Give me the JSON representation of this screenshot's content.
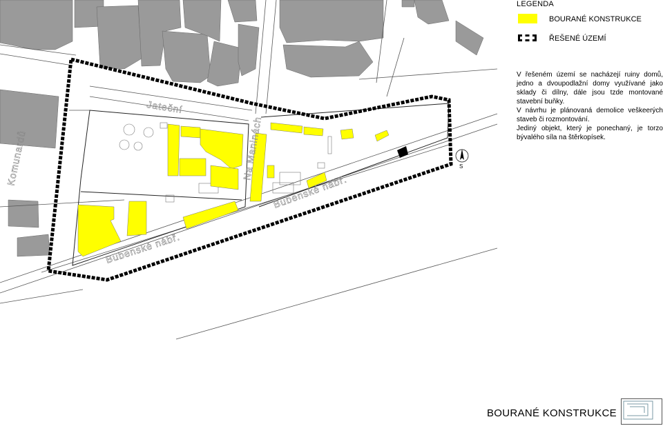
{
  "legend": {
    "title": "LEGENDA",
    "items": [
      {
        "label": "BOURANÉ KONSTRUKCE",
        "color": "#ffff00",
        "symbol": "yellow-fill"
      },
      {
        "label": "ŘEŠENÉ ÚZEMÍ",
        "color": "#000000",
        "symbol": "dashed-boundary"
      }
    ]
  },
  "notes": [
    "V řešeném území se nacházejí ruiny domů, jedno a dvoupodlažní domy využívané jako sklady či dílny, dále jsou tzde montované stavební buňky.",
    "V návrhu je plánovaná demolice veškeerých staveb či rozmontování.",
    "Jediný objekt, který je ponechaný, je torzo bývalého síla na štěrkopísek."
  ],
  "north_arrow": {
    "label": "S",
    "icon": "north-arrow-icon"
  },
  "street_labels": {
    "jatecni": "Jateční",
    "na_maninach": "Na Maninách",
    "bubenske_nabr_1": "Bubenské nábř.",
    "bubenske_nabr_2": "Bubenské nábř.",
    "komunardu": "Komunardů"
  },
  "sheet_title": "BOURANÉ KONSTRUKCE",
  "colors": {
    "demolished": "#ffff00",
    "buildings": "#9e9e9e",
    "boundary": "#000000",
    "retained_object": "#000000",
    "lines": "#555555"
  }
}
